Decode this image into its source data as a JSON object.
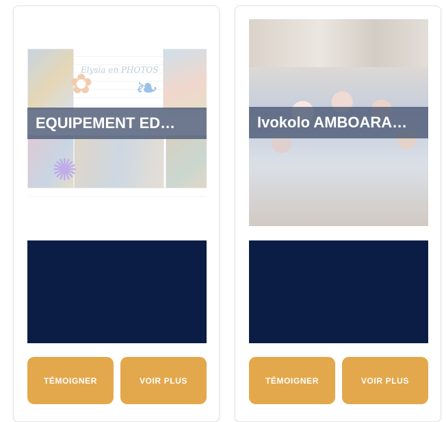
{
  "cards": [
    {
      "title": "EQUIPEMENT ED…",
      "image_caption": "Elysia en PHOTOS",
      "temoigner_label": "TÉMOIGNER",
      "voir_plus_label": "VOIR PLUS"
    },
    {
      "title": "Ivokolo AMBOARA…",
      "temoigner_label": "TÉMOIGNER",
      "voir_plus_label": "VOIR PLUS"
    }
  ],
  "colors": {
    "button": "#e3a84c",
    "video_block": "#0b1d44",
    "overlay": "#4e5c76"
  }
}
